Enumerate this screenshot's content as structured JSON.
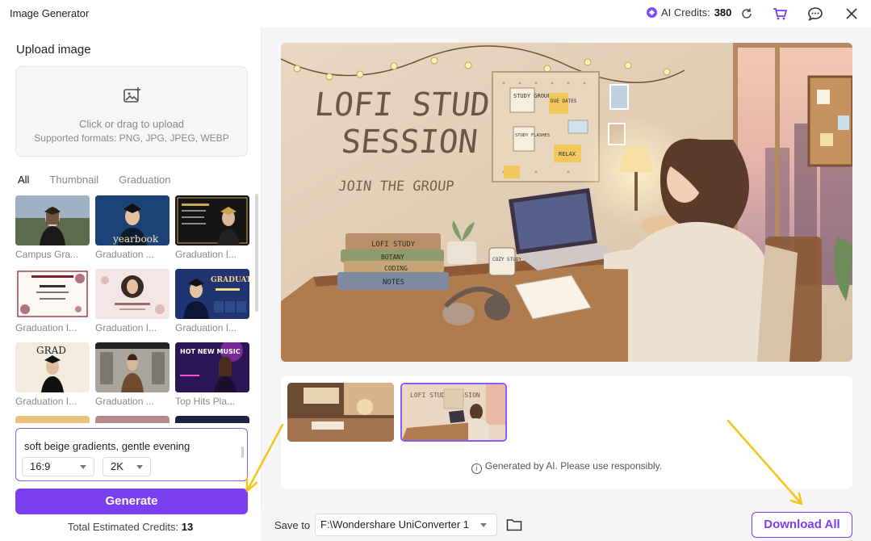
{
  "app": {
    "title": "Image Generator",
    "credits_label": "AI Credits:",
    "credits_value": "380"
  },
  "upload": {
    "title": "Upload image",
    "line1": "Click or drag to upload",
    "line2": "Supported formats: PNG, JPG, JPEG, WEBP"
  },
  "tabs": [
    {
      "label": "All",
      "active": true
    },
    {
      "label": "Thumbnail",
      "active": false
    },
    {
      "label": "Graduation",
      "active": false
    }
  ],
  "templates": [
    {
      "caption": "Campus Gra..."
    },
    {
      "caption": "Graduation ...",
      "overlay_text": "yearbook"
    },
    {
      "caption": "Graduation I..."
    },
    {
      "caption": "Graduation I..."
    },
    {
      "caption": "Graduation I..."
    },
    {
      "caption": "Graduation I...",
      "overlay_text": "GRADUATION"
    },
    {
      "caption": "Graduation I...",
      "overlay_text": "GRAD"
    },
    {
      "caption": "Graduation ..."
    },
    {
      "caption": "Top Hits Pla...",
      "overlay_text": "HOT NEW MUSIC"
    }
  ],
  "prompt": {
    "text": "soft beige gradients, gentle evening",
    "ratio": "16:9",
    "resolution": "2K"
  },
  "generate": {
    "label": "Generate",
    "total_label": "Total Estimated Credits:",
    "total_value": "13"
  },
  "main_image": {
    "title_line1": "LOFI STUDY",
    "title_line2": "SESSION",
    "subtitle": "JOIN THE GROUP",
    "notes": [
      "STUDY GROUP",
      "DUE DATES",
      "STUDY FLASHES",
      "RELAX"
    ],
    "books": [
      "LOFI STUDY",
      "BOTANY",
      "CODING",
      "NOTES"
    ],
    "mug": "COZY STUDY CO."
  },
  "results": {
    "notice": "Generated by AI. Please use responsibly.",
    "thumb_title": "LOFI STUDY SESSION"
  },
  "save": {
    "label": "Save to",
    "path": "F:\\Wondershare UniConverter 1",
    "download_label": "Download All"
  },
  "colors": {
    "accent": "#7b3ff2",
    "annotation_arrow": "#f5c518"
  }
}
